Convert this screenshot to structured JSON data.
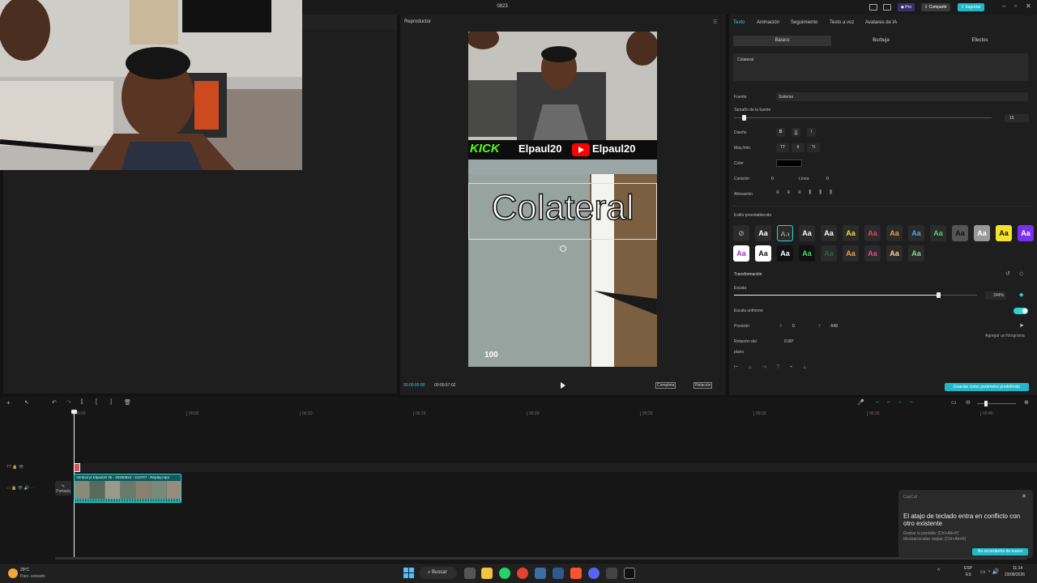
{
  "window": {
    "title": "0823",
    "pro_label": "Pro",
    "share_label": "Compartir",
    "export_label": "Exportar"
  },
  "player": {
    "title": "Reproductor",
    "time_current": "00:00:00:00",
    "time_total": "00:00:57:02",
    "full_label": "Completa",
    "ratio_label": "Relación"
  },
  "overlay": {
    "kick": "KICK",
    "channel1": "Elpaul20",
    "channel2": "Elpaul20",
    "caption": "Colateral",
    "hp": "100"
  },
  "props": {
    "tabs": [
      "Texto",
      "Animación",
      "Seguimiento",
      "Texto a voz",
      "Avatares de IA"
    ],
    "subtabs": [
      "Básico",
      "Burbuja",
      "Efectos"
    ],
    "text_value": "Colateral",
    "font_label": "Fuente",
    "font_value": "Sistema",
    "size_label": "Tamaño de la fuente",
    "size_value": "15",
    "design_label": "Diseño",
    "case_label": "May./min.",
    "color_label": "Color",
    "char_label": "Carácter",
    "char_value": "0",
    "line_label": "Línea",
    "line_value": "0",
    "align_label": "Alineación",
    "preset_label": "Estilo preestablecido",
    "transform_label": "Transformación",
    "scale_label": "Escala",
    "scale_value": "244%",
    "scale_fraction": 0.84,
    "uniform_label": "Escala uniforme",
    "pos_label": "Posición",
    "pos_x_label": "X",
    "pos_x": "0",
    "pos_y_label": "Y",
    "pos_y": "-549",
    "rot_label": "Rotación del",
    "rot_label2": "plano",
    "rot_value": "0.00°",
    "keyframe_tip": "Agregar un fotograma",
    "save_default": "Guardar como parámetro predefinido"
  },
  "timeline": {
    "ticks": [
      "00:00",
      "00:05",
      "00:10",
      "00:15",
      "00:20",
      "00:25",
      "00:30",
      "00:35",
      "00:40"
    ],
    "clip_label": "Vertical yt Elpaul20 2k - 20260822 - 213707 - Replay.mp4",
    "cover_label": "Portada"
  },
  "notification": {
    "app": "CapCut",
    "title": "El atajo de teclado entra en conflicto con otro existente",
    "line1": "Grabar la pantalla: [Ctrl+Alt+P]",
    "line2": "Mostrar/ocultar reglas: [Ctrl+Alt+R]",
    "button": "No recordarme de nuevo"
  },
  "taskbar": {
    "temp": "29°C",
    "weather": "Parc. soleado",
    "search": "Buscar",
    "lang": "ESP",
    "lang2": "ES",
    "time": "11:14",
    "date": "23/08/2026"
  },
  "colors": {
    "accent": "#2fd3d3",
    "kick": "#53fc18",
    "youtube": "#ff0000"
  }
}
